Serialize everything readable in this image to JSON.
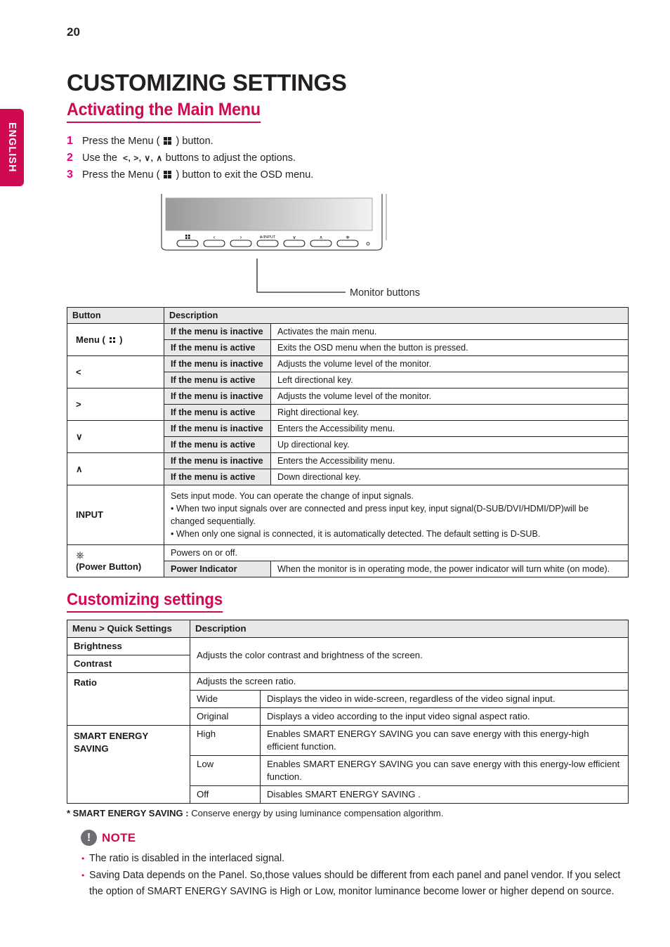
{
  "page": {
    "number": "20",
    "language_tab": "ENGLISH",
    "chapter_title": "CUSTOMIZING SETTINGS",
    "section_title": "Activating the Main Menu"
  },
  "steps": [
    {
      "num": "1",
      "before": "Press the Menu ( ",
      "icon": "menu-grid-icon",
      "after": " ) button."
    },
    {
      "num": "2",
      "before": "Use the  ",
      "keys": "<, >, ∨, ∧",
      "after": " buttons to adjust the options."
    },
    {
      "num": "3",
      "before": "Press the Menu ( ",
      "icon": "menu-grid-icon",
      "after": " ) button to exit the OSD menu."
    }
  ],
  "figure": {
    "callout_label": "Monitor buttons",
    "buttons": [
      {
        "name": "menu-button",
        "glyph": "grid"
      },
      {
        "name": "left-button",
        "glyph": "‹"
      },
      {
        "name": "right-button",
        "glyph": "›"
      },
      {
        "name": "input-button",
        "glyph": "/INPUT"
      },
      {
        "name": "down-button",
        "glyph": "∨"
      },
      {
        "name": "up-button",
        "glyph": "∧"
      },
      {
        "name": "power-button",
        "glyph": "⏻"
      }
    ]
  },
  "button_table": {
    "headers": {
      "col1": "Button",
      "col2": "Description"
    },
    "rows": [
      {
        "button": "Menu ( ",
        "button_suffix": " )",
        "button_has_icon": true,
        "pairs": [
          {
            "condition": "If the menu is inactive",
            "description": "Activates the main menu."
          },
          {
            "condition": "If the menu is active",
            "description": "Exits the OSD menu when the button is pressed."
          }
        ]
      },
      {
        "button": "<",
        "button_has_icon": false,
        "pairs": [
          {
            "condition": "If the menu is inactive",
            "description": "Adjusts the volume level of the monitor."
          },
          {
            "condition": "If the menu is active",
            "description": "Left directional key."
          }
        ]
      },
      {
        "button": ">",
        "button_has_icon": false,
        "pairs": [
          {
            "condition": "If the menu is inactive",
            "description": "Adjusts the volume level of the monitor."
          },
          {
            "condition": "If the menu is active",
            "description": "Right directional key."
          }
        ]
      },
      {
        "button": "∨",
        "button_has_icon": false,
        "pairs": [
          {
            "condition": "If the menu is inactive",
            "description": "Enters the Accessibility menu."
          },
          {
            "condition": "If the menu is active",
            "description": "Up directional key."
          }
        ]
      },
      {
        "button": "∧",
        "button_has_icon": false,
        "pairs": [
          {
            "condition": "If the menu is inactive",
            "description": "Enters the Accessibility menu."
          },
          {
            "condition": "If the menu is active",
            "description": "Down directional key."
          }
        ]
      }
    ],
    "input_row": {
      "label": "INPUT",
      "lines": [
        "Sets input mode. You can operate the change of input signals.",
        "• When two input signals over are connected and press input key, input signal(D-SUB/DVI/HDMI/DP)will be changed sequentially.",
        "• When only one signal is connected, it is automatically detected. The default setting is D-SUB."
      ]
    },
    "power_row": {
      "label": "(Power Button)",
      "icon": "power-icon",
      "top_description": "Powers on or off.",
      "indicator_label": "Power Indicator",
      "indicator_description": "When the monitor is in operating mode, the power indicator will turn white (on mode)."
    }
  },
  "customizing": {
    "heading": "Customizing settings",
    "headers": {
      "col1": "Menu > Quick Settings",
      "col2": "Description"
    },
    "brightness": "Brightness",
    "contrast": "Contrast",
    "brightness_contrast_desc": "Adjusts the color contrast and brightness of the screen.",
    "ratio": "Ratio",
    "ratio_desc": "Adjusts the screen ratio.",
    "ratio_options": [
      {
        "name": "Wide",
        "desc": "Displays the video in wide-screen, regardless of the video signal input."
      },
      {
        "name": "Original",
        "desc": "Displays a video according to the input video signal aspect ratio."
      }
    ],
    "ses_label": "SMART ENERGY SAVING",
    "ses_options": [
      {
        "name": "High",
        "desc": "Enables SMART ENERGY SAVING  you can save energy with this energy-high efficient function."
      },
      {
        "name": "Low",
        "desc": "Enables SMART ENERGY SAVING  you can save energy with this energy-low efficient function."
      },
      {
        "name": "Off",
        "desc": "Disables SMART ENERGY SAVING ."
      }
    ],
    "footnote_bold": "* SMART ENERGY SAVING :",
    "footnote_rest": " Conserve energy by using luminance compensation algorithm."
  },
  "note": {
    "title": "NOTE",
    "icon": "exclamation-icon",
    "items": [
      "The ratio is disabled in the interlaced signal.",
      "Saving Data depends on the Panel. So,those values should be different from each panel and panel vendor. If you select the option of SMART ENERGY SAVING is High or Low, monitor luminance become lower or higher depend on source."
    ]
  },
  "colors": {
    "accent_pink": "#cf0a52",
    "accent_magenta": "#e4007f",
    "table_header_gray": "#e8e8e8",
    "note_icon_gray": "#6d6e71"
  }
}
